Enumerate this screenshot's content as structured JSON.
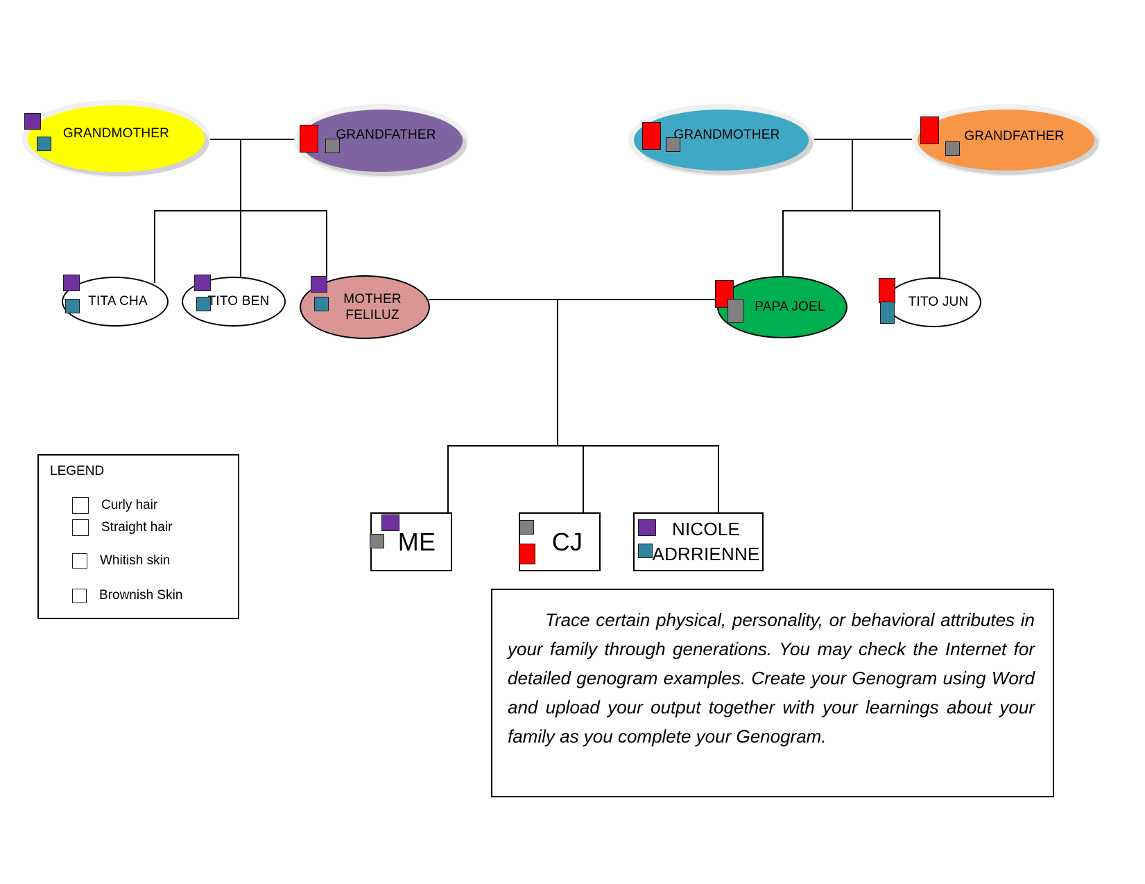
{
  "title": "Family Genogram",
  "colors": {
    "curly_hair": "#7030a0",
    "straight_hair": "#ff0000",
    "whitish_skin": "#31849b",
    "brownish_skin": "#808080",
    "maternal_grandmother_fill": "#ffff00",
    "maternal_grandfather_fill": "#8064a2",
    "paternal_grandmother_fill": "#3fa8c4",
    "paternal_grandfather_fill": "#f79646",
    "mother_fill": "#d99694",
    "father_fill": "#00b050",
    "blank_fill": "#ffffff",
    "line": "#000000"
  },
  "generations": {
    "grandparents": [
      {
        "id": "maternal-grandmother",
        "label": "GRANDMOTHER",
        "shape": "ellipse",
        "traits": [
          "curly",
          "whitish"
        ]
      },
      {
        "id": "maternal-grandfather",
        "label": "GRANDFATHER",
        "shape": "ellipse",
        "traits": [
          "straight",
          "brownish"
        ]
      },
      {
        "id": "paternal-grandmother",
        "label": "GRANDMOTHER",
        "shape": "ellipse",
        "traits": [
          "straight",
          "brownish"
        ]
      },
      {
        "id": "paternal-grandfather",
        "label": "GRANDFATHER",
        "shape": "ellipse",
        "traits": [
          "straight",
          "brownish"
        ]
      }
    ],
    "parents": [
      {
        "id": "tita-cha",
        "label": "TITA CHA",
        "shape": "ellipse",
        "traits": [
          "curly",
          "whitish"
        ]
      },
      {
        "id": "tito-ben",
        "label": "TITO BEN",
        "shape": "ellipse",
        "traits": [
          "curly",
          "whitish"
        ]
      },
      {
        "id": "mother-feliluz",
        "label": "MOTHER FELILUZ",
        "label_line1": "MOTHER",
        "label_line2": "FELILUZ",
        "shape": "ellipse",
        "traits": [
          "curly",
          "whitish"
        ]
      },
      {
        "id": "papa-joel",
        "label": "PAPA JOEL",
        "shape": "ellipse",
        "traits": [
          "straight",
          "brownish"
        ]
      },
      {
        "id": "tito-jun",
        "label": "TITO JUN",
        "shape": "ellipse",
        "traits": [
          "straight",
          "whitish"
        ]
      }
    ],
    "children": [
      {
        "id": "me",
        "label": "ME",
        "shape": "rect",
        "traits": [
          "curly",
          "brownish"
        ]
      },
      {
        "id": "cj",
        "label": "CJ",
        "shape": "rect",
        "traits": [
          "brownish",
          "straight"
        ]
      },
      {
        "id": "nicole-adrrienne",
        "label": "NICOLE ADRRIENNE",
        "label_line1": "NICOLE",
        "label_line2": "ADRRIENNE",
        "shape": "rect",
        "traits": [
          "curly",
          "whitish"
        ]
      }
    ]
  },
  "legend": {
    "title": "LEGEND",
    "items": [
      {
        "key": "curly",
        "label": "Curly hair"
      },
      {
        "key": "straight",
        "label": "Straight hair"
      },
      {
        "key": "whitish",
        "label": "Whitish skin"
      },
      {
        "key": "brownish",
        "label": "Brownish Skin"
      }
    ]
  },
  "instructions": {
    "text": "Trace certain physical, personality, or behavioral attributes in your family through generations. You may check the Internet for detailed genogram examples. Create your Genogram using Word and upload your output together with your learnings about your family as you complete your Genogram."
  }
}
